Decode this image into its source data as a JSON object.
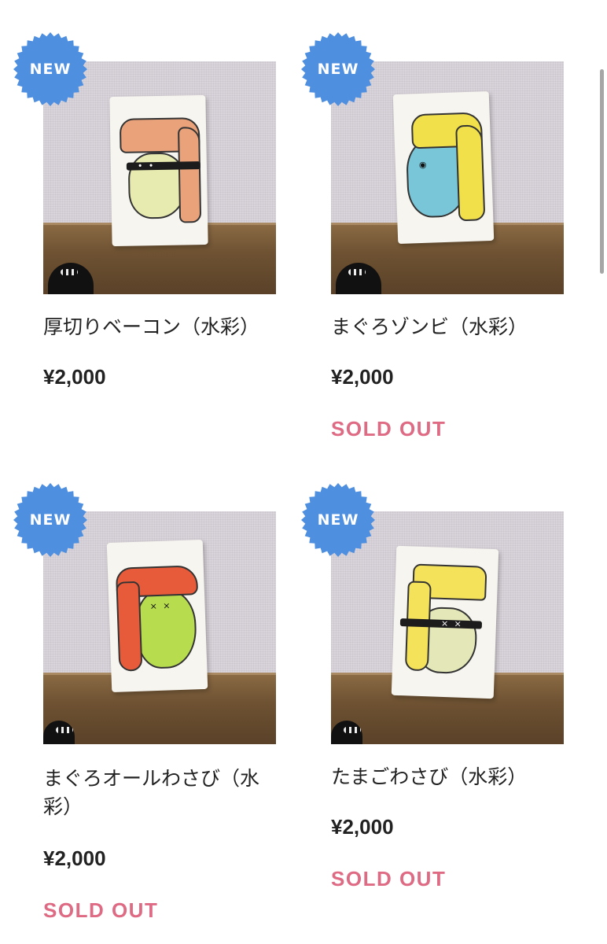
{
  "products": [
    {
      "badge": "NEW",
      "title": "厚切りベーコン（水彩）",
      "price": "¥2,000",
      "status": "",
      "art": {
        "top": "#e9a27a",
        "body": "#e8ebb0",
        "band": true,
        "eyes": "• •"
      }
    },
    {
      "badge": "NEW",
      "title": "まぐろゾンビ（水彩）",
      "price": "¥2,000",
      "status": "SOLD OUT",
      "art": {
        "top": "#f2e04a",
        "body": "#79c6d8",
        "band": false,
        "eyes": "◉"
      }
    },
    {
      "badge": "NEW",
      "title": "まぐろオールわさび（水彩）",
      "price": "¥2,000",
      "status": "SOLD OUT",
      "art": {
        "top": "#e85b3a",
        "body": "#b7dc4e",
        "band": false,
        "eyes": "× ×"
      }
    },
    {
      "badge": "NEW",
      "title": "たまごわさび（水彩）",
      "price": "¥2,000",
      "status": "SOLD OUT",
      "art": {
        "top": "#f4e25a",
        "body": "#e4e8b8",
        "band": true,
        "eyes": "× ×"
      }
    }
  ],
  "colors": {
    "badge": "#4f8fe0",
    "sold_out": "#de6a84",
    "text": "#222222"
  }
}
